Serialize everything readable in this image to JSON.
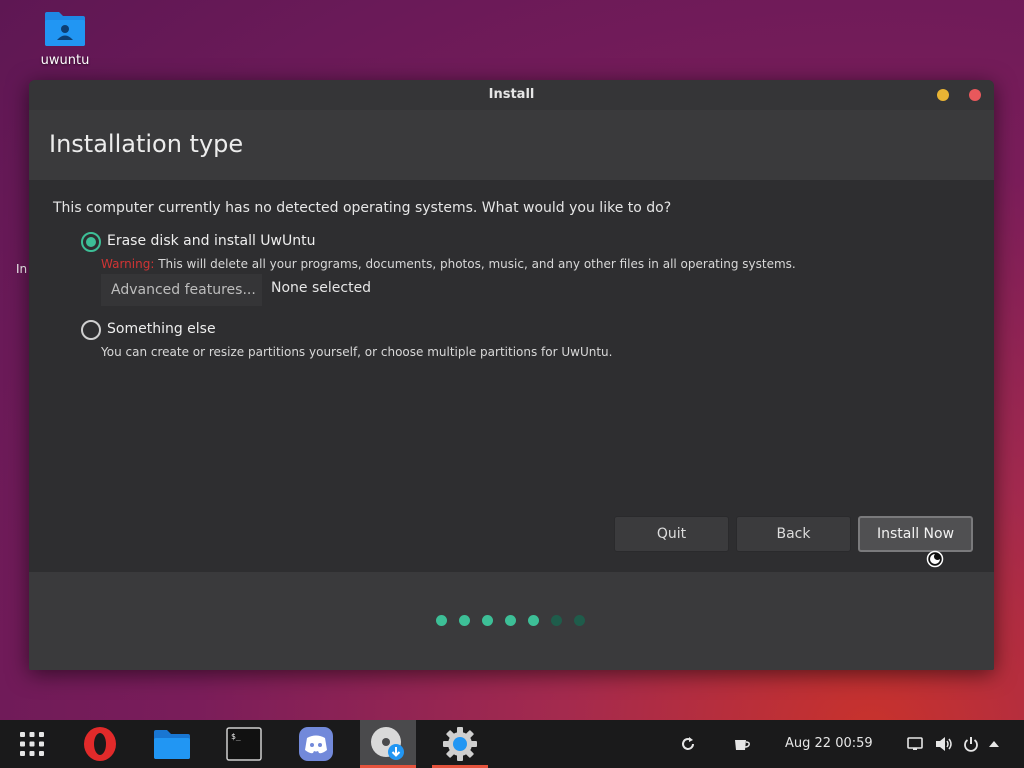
{
  "desktop": {
    "folder_label": "uwuntu",
    "edge_text": "In"
  },
  "window": {
    "title": "Install",
    "header_title": "Installation type",
    "question": "This computer currently has no detected operating systems. What would you like to do?",
    "options": [
      {
        "label": "Erase disk and install UwUntu",
        "checked": true,
        "warning_prefix": "Warning:",
        "description": "This will delete all your programs, documents, photos, music, and any other files in all operating systems."
      },
      {
        "label": "Something else",
        "checked": false,
        "description": "You can create or resize partitions yourself, or choose multiple partitions for UwUntu."
      }
    ],
    "advanced_button": "Advanced features...",
    "advanced_status": "None selected",
    "buttons": {
      "quit": "Quit",
      "back": "Back",
      "install": "Install Now"
    },
    "progress": {
      "total_steps": 7,
      "completed_steps": 5
    }
  },
  "taskbar": {
    "apps": [
      {
        "name": "app-grid-icon",
        "active": false
      },
      {
        "name": "opera-icon",
        "active": false
      },
      {
        "name": "files-icon",
        "active": false
      },
      {
        "name": "terminal-icon",
        "active": false
      },
      {
        "name": "discord-icon",
        "active": false
      },
      {
        "name": "installer-icon",
        "active": true
      },
      {
        "name": "settings-icon",
        "active": false
      }
    ],
    "clock": "Aug 22  00:59"
  },
  "colors": {
    "accent": "#3dbf97",
    "warning": "#d03434",
    "active_underline": "#e5533d"
  }
}
